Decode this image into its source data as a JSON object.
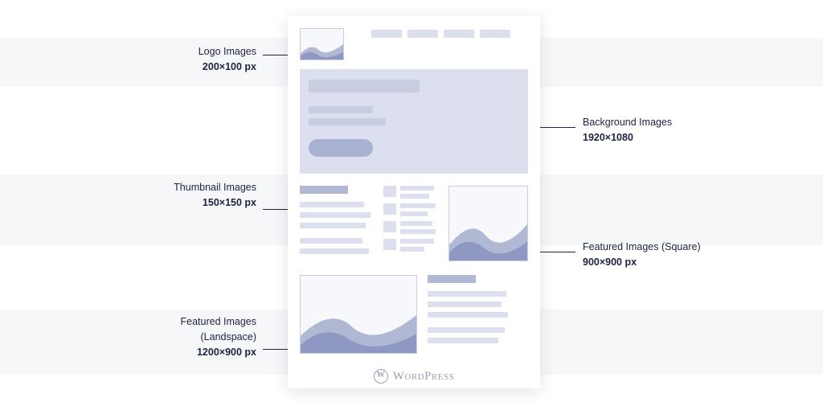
{
  "callouts": {
    "logo": {
      "title": "Logo Images",
      "dim": "200×100 px"
    },
    "thumbnail": {
      "title": "Thumbnail Images",
      "dim": "150×150 px"
    },
    "landscape": {
      "title1": "Featured Images",
      "title2": "(Landspace)",
      "dim": "1200×900 px"
    },
    "background": {
      "title": "Background Images",
      "dim": "1920×1080"
    },
    "square": {
      "title": "Featured Images (Square)",
      "dim": "900×900 px"
    }
  },
  "brand": "WordPress"
}
